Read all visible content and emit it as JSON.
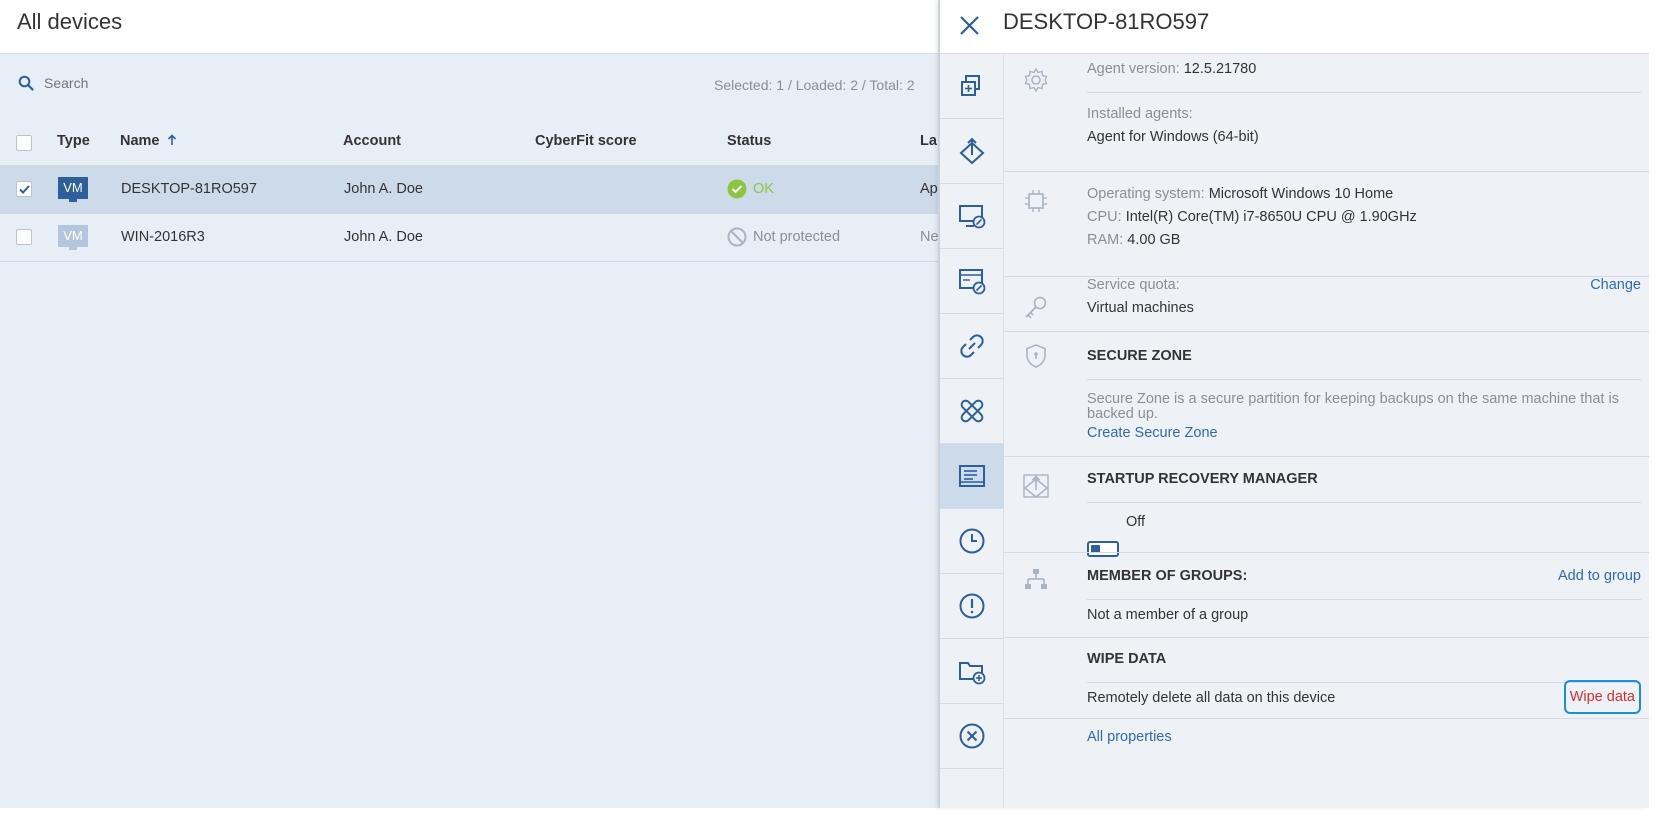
{
  "main": {
    "title": "All devices",
    "search_placeholder": "Search",
    "counts": "Selected: 1 / Loaded: 2 / Total: 2",
    "columns": {
      "type": "Type",
      "name": "Name",
      "account": "Account",
      "cyberfit": "CyberFit score",
      "status": "Status",
      "last": "La"
    },
    "rows": [
      {
        "type": "VM",
        "name": "DESKTOP-81RO597",
        "account": "John A. Doe",
        "cyberfit": "",
        "status": "OK",
        "last": "Ap",
        "selected": true
      },
      {
        "type": "VM",
        "name": "WIN-2016R3",
        "account": "John A. Doe",
        "cyberfit": "",
        "status": "Not protected",
        "last": "Ne",
        "selected": false
      }
    ]
  },
  "panel": {
    "title": "DESKTOP-81RO597",
    "rail_icons": [
      "copy-icon",
      "recovery-icon",
      "desktop-remote-icon",
      "window-remote-icon",
      "link-icon",
      "patch-icon",
      "details-icon",
      "clock-icon",
      "alert-icon",
      "folder-add-icon",
      "cancel-icon"
    ],
    "agent": {
      "version_label": "Agent version:",
      "version_value": "12.5.21780",
      "installed_label": "Installed agents:",
      "installed_value": "Agent for Windows (64-bit)"
    },
    "system": {
      "os_label": "Operating system:",
      "os_value": "Microsoft Windows 10 Home",
      "cpu_label": "CPU:",
      "cpu_value": "Intel(R) Core(TM) i7-8650U CPU @ 1.90GHz",
      "ram_label": "RAM:",
      "ram_value": "4.00 GB"
    },
    "quota": {
      "label": "Service quota:",
      "value": "Virtual machines",
      "change_label": "Change"
    },
    "secure_zone": {
      "heading": "SECURE ZONE",
      "description_line1": "Secure Zone is a secure partition for keeping backups on the same machine that is",
      "description_line2": "backed up.",
      "create_label": "Create Secure Zone"
    },
    "startup": {
      "heading": "STARTUP RECOVERY MANAGER",
      "toggle_label": "Off"
    },
    "groups": {
      "heading": "MEMBER OF GROUPS:",
      "add_label": "Add to group",
      "value": "Not a member of a group"
    },
    "wipe": {
      "heading": "WIPE DATA",
      "description": "Remotely delete all data on this device",
      "action_label": "Wipe data"
    },
    "all_properties": "All properties"
  },
  "colors": {
    "accent": "#2d6cb5",
    "ok": "#8cc63f",
    "danger": "#d2322d",
    "selected_row": "#cddaea"
  }
}
